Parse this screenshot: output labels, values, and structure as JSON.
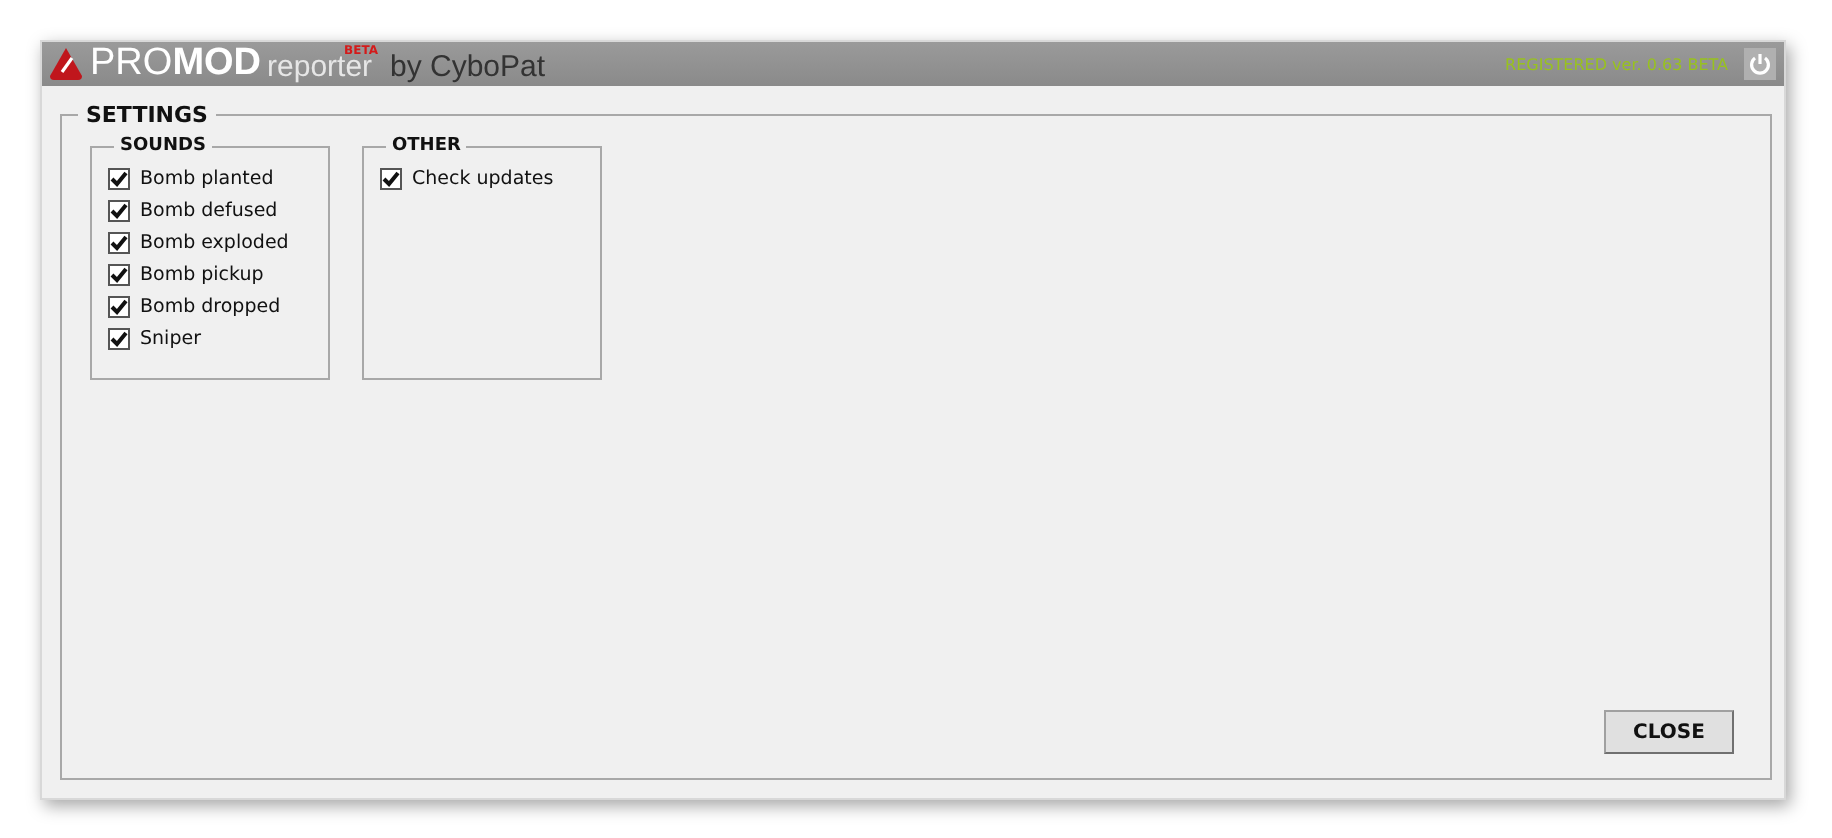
{
  "window": {
    "logo": "PRO**MOD**",
    "subtitle": "reporter",
    "badge": "BETA",
    "author": "by CyboPat",
    "registration": "REGISTERED ver. 0.63 BETA"
  },
  "settings": {
    "title": "SETTINGS",
    "groups": [
      {
        "title": "SOUNDS",
        "items": [
          {
            "label": "Bomb planted",
            "checked": true
          },
          {
            "label": "Bomb defused",
            "checked": true
          },
          {
            "label": "Bomb exploded",
            "checked": true
          },
          {
            "label": "Bomb pickup",
            "checked": true
          },
          {
            "label": "Bomb dropped",
            "checked": true
          },
          {
            "label": "Sniper",
            "checked": true
          }
        ]
      },
      {
        "title": "OTHER",
        "items": [
          {
            "label": "Check updates",
            "checked": true
          }
        ]
      }
    ]
  },
  "buttons": [
    "CLOSE"
  ]
}
